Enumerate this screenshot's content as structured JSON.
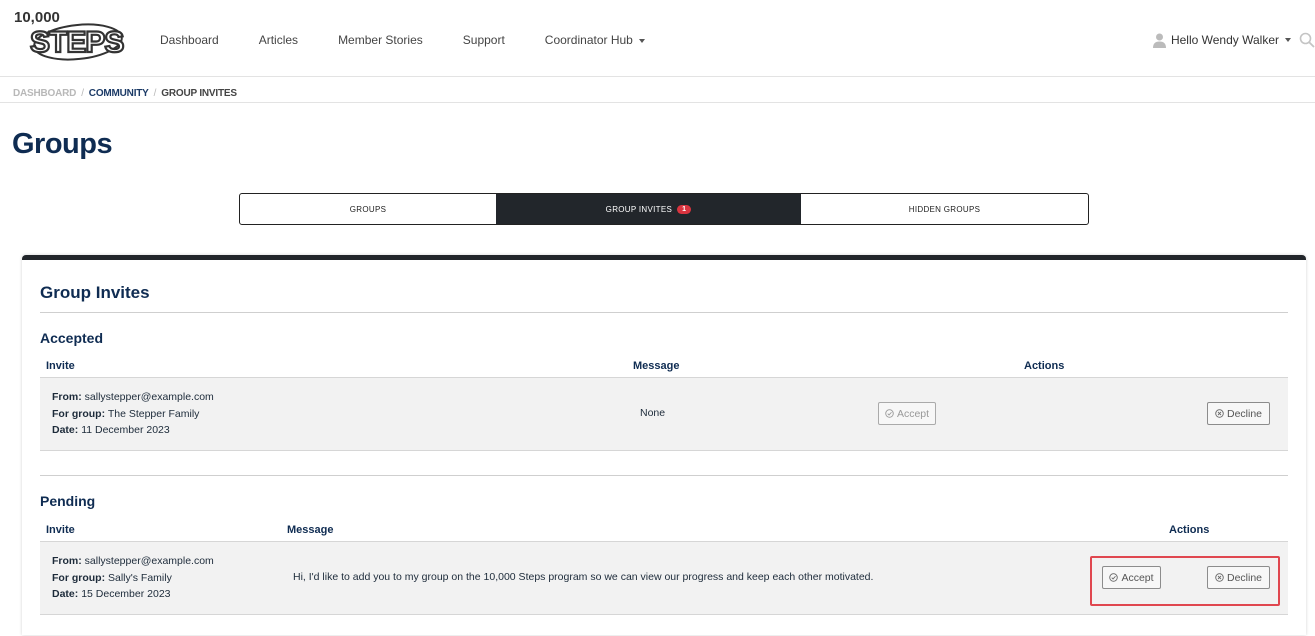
{
  "logo": {
    "top_text": "10,000",
    "main_text": "STEPS"
  },
  "nav": {
    "items": [
      "Dashboard",
      "Articles",
      "Member Stories",
      "Support",
      "Coordinator Hub"
    ]
  },
  "user": {
    "greeting": "Hello Wendy Walker"
  },
  "breadcrumb": [
    "DASHBOARD",
    "COMMUNITY",
    "GROUP INVITES"
  ],
  "breadcrumb_sep": "/",
  "page_title": "Groups",
  "tabs": [
    {
      "label": "GROUPS",
      "active": false
    },
    {
      "label": "GROUP INVITES",
      "active": true,
      "badge": "1"
    },
    {
      "label": "HIDDEN GROUPS",
      "active": false
    }
  ],
  "card": {
    "title": "Group Invites",
    "accepted": {
      "title": "Accepted",
      "headers": {
        "invite": "Invite",
        "message": "Message",
        "actions": "Actions"
      },
      "row": {
        "from_label": "From:",
        "from": "sallystepper@example.com",
        "group_label": "For group:",
        "group": "The Stepper Family",
        "date_label": "Date:",
        "date": "11 December 2023",
        "message": "None",
        "accept_label": "Accept",
        "decline_label": "Decline"
      }
    },
    "pending": {
      "title": "Pending",
      "headers": {
        "invite": "Invite",
        "message": "Message",
        "actions": "Actions"
      },
      "row": {
        "from_label": "From:",
        "from": "sallystepper@example.com",
        "group_label": "For group:",
        "group": "Sally's Family",
        "date_label": "Date:",
        "date": "15 December 2023",
        "message": "Hi, I'd like to add you to my group on the 10,000 Steps program so we can view our progress and keep each other motivated.",
        "accept_label": "Accept",
        "decline_label": "Decline"
      }
    }
  },
  "colors": {
    "brand_navy": "#0f2c52",
    "tab_active_bg": "#22262b",
    "badge_red": "#d9343f",
    "highlight_red": "#e0474f"
  }
}
